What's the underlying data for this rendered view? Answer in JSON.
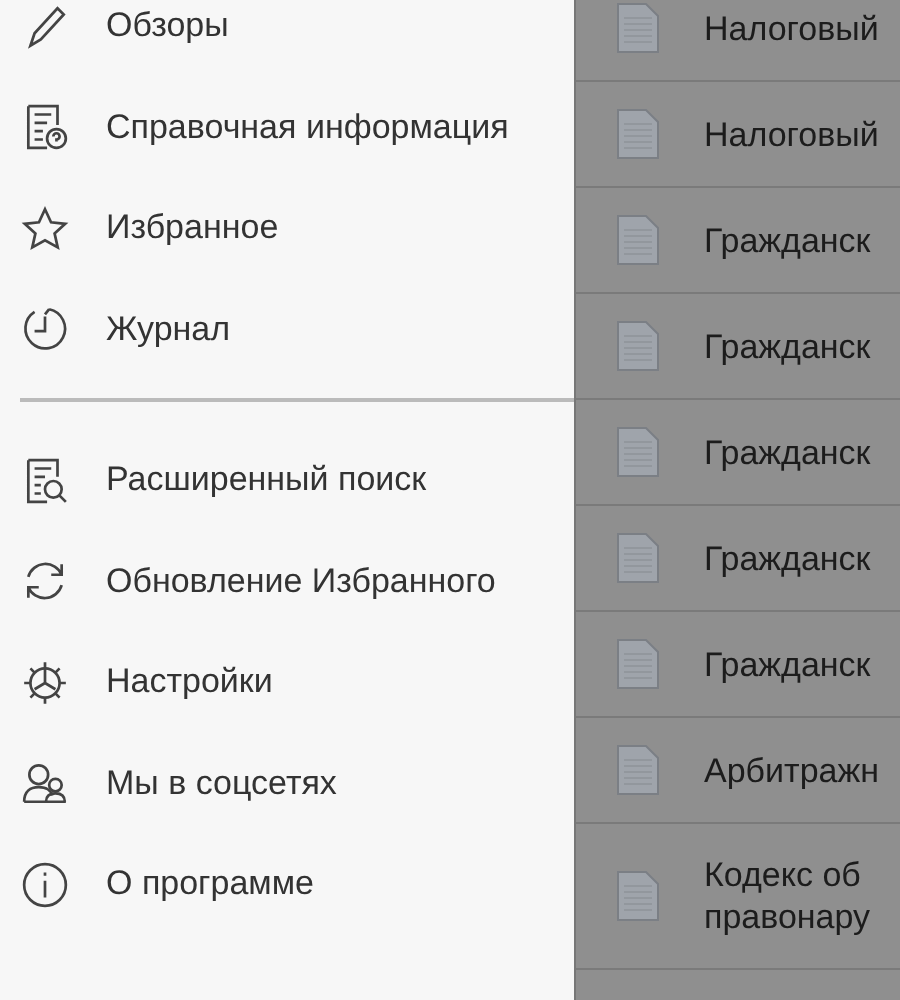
{
  "menu": {
    "sections": [
      {
        "items": [
          {
            "label": "Обзоры"
          },
          {
            "label": "Справочная информация"
          },
          {
            "label": "Избранное"
          },
          {
            "label": "Журнал"
          }
        ]
      },
      {
        "items": [
          {
            "label": "Расширенный поиск"
          },
          {
            "label": "Обновление Избранного"
          },
          {
            "label": "Настройки"
          },
          {
            "label": "Мы в соцсетях"
          },
          {
            "label": "О программе"
          }
        ]
      }
    ]
  },
  "documents": [
    {
      "lines": [
        "Налоговый"
      ]
    },
    {
      "lines": [
        "Налоговый"
      ]
    },
    {
      "lines": [
        "Гражданск"
      ]
    },
    {
      "lines": [
        "Гражданск"
      ]
    },
    {
      "lines": [
        "Гражданск"
      ]
    },
    {
      "lines": [
        "Гражданск"
      ]
    },
    {
      "lines": [
        "Гражданск"
      ]
    },
    {
      "lines": [
        "Арбитражн"
      ]
    },
    {
      "lines": [
        "Кодекс об",
        "правонару"
      ]
    }
  ]
}
